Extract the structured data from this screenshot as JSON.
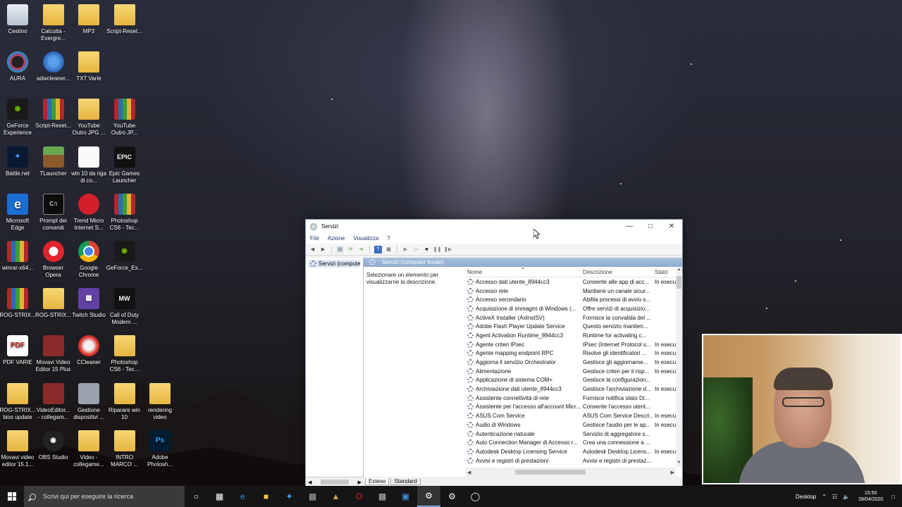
{
  "desktop": {
    "icons": [
      {
        "label": "Cestino",
        "icon": "recycle-bin-icon"
      },
      {
        "label": "Calcutta - Evergre...",
        "icon": "file-icon"
      },
      {
        "label": "MP3",
        "icon": "file-icon"
      },
      {
        "label": "Script-Reset...",
        "icon": "folder-icon"
      },
      {
        "label": "AURA",
        "icon": "aura-icon"
      },
      {
        "label": "adwcleaner...",
        "icon": "adwcleaner-icon"
      },
      {
        "label": "TXT Varie",
        "icon": "file-icon"
      },
      {
        "label": "GeForce Experience",
        "icon": "nvidia-icon"
      },
      {
        "label": "Script-Reset...",
        "icon": "winrar-icon"
      },
      {
        "label": "YouTube Outro JPG ...",
        "icon": "file-icon"
      },
      {
        "label": "YouTube Outro JP...",
        "icon": "winrar-icon"
      },
      {
        "label": "Battle.net",
        "icon": "battlenet-icon"
      },
      {
        "label": "TLauncher",
        "icon": "minecraft-icon"
      },
      {
        "label": "win 10 da riga di co...",
        "icon": "text-file-icon"
      },
      {
        "label": "Epic Games Launcher",
        "icon": "epic-games-icon"
      },
      {
        "label": "Microsoft Edge",
        "icon": "edge-icon"
      },
      {
        "label": "Prompt dei comandi",
        "icon": "cmd-icon"
      },
      {
        "label": "Trend Micro Internet S...",
        "icon": "trend-micro-icon"
      },
      {
        "label": "Photoshop CS6 - Tec...",
        "icon": "winrar-icon"
      },
      {
        "label": "winrar-x64...",
        "icon": "winrar-icon"
      },
      {
        "label": "Browser Opera",
        "icon": "opera-icon"
      },
      {
        "label": "Google Chrome",
        "icon": "chrome-icon"
      },
      {
        "label": "GeForce_Ex...",
        "icon": "nvidia-icon"
      },
      {
        "label": "ROG-STRIX...",
        "icon": "winrar-icon"
      },
      {
        "label": "ROG-STRIX...",
        "icon": "file-icon"
      },
      {
        "label": "Twitch Studio",
        "icon": "twitch-icon"
      },
      {
        "label": "Call of Duty Modern ...",
        "icon": "cod-icon"
      },
      {
        "label": "PDF VARIE",
        "icon": "pdf-icon"
      },
      {
        "label": "Movavi Video Editor 15 Plus",
        "icon": "movavi-icon"
      },
      {
        "label": "CCleaner",
        "icon": "ccleaner-icon"
      },
      {
        "label": "Photoshop CS6 - Tec...",
        "icon": "folder-icon"
      },
      {
        "label": "ROG-STRIX... bios update",
        "icon": "file-icon"
      },
      {
        "label": "VideoEditor... - collegam...",
        "icon": "movavi-icon"
      },
      {
        "label": "Gestione dispositivi ...",
        "icon": "device-manager-icon"
      },
      {
        "label": "Riparare win 10",
        "icon": "file-icon"
      },
      {
        "label": "rendering video",
        "icon": "file-icon"
      },
      {
        "label": "Movavi video editor 15.1...",
        "icon": "folder-icon"
      },
      {
        "label": "OBS Studio",
        "icon": "obs-icon"
      },
      {
        "label": "Video - collegame...",
        "icon": "file-icon"
      },
      {
        "label": "INTRO MARCO ...",
        "icon": "file-icon"
      },
      {
        "label": "Adobe Photosh...",
        "icon": "photoshop-icon"
      }
    ]
  },
  "window": {
    "title": "Servizi",
    "menu": [
      "File",
      "Azione",
      "Visualizza",
      "?"
    ],
    "tree_item": "Servizi (computer",
    "header": "Servizi (computer locale)",
    "description_hint": "Selezionare un elemento per visualizzarne la descrizione.",
    "columns": {
      "name": "Nome",
      "description": "Descrizione",
      "state": "Stato"
    },
    "tabs": [
      "Esteso",
      "Standard"
    ],
    "services": [
      {
        "name": "Accesso dati utente_8944cc3",
        "description": "Consente alle app di acc...",
        "state": "In esecu"
      },
      {
        "name": "Accesso rete",
        "description": "Mantiene un canale sicur...",
        "state": ""
      },
      {
        "name": "Accesso secondario",
        "description": "Abilita processi di avvio s...",
        "state": ""
      },
      {
        "name": "Acquisizione di immagini di Windows (...",
        "description": "Offre servizi di acquisizio...",
        "state": ""
      },
      {
        "name": "ActiveX Installer (AxInstSV)",
        "description": "Fornisce la convalida del ...",
        "state": ""
      },
      {
        "name": "Adobe Flash Player Update Service",
        "description": "Questo servizio mantien...",
        "state": ""
      },
      {
        "name": "Agent Activation Runtime_8944cc3",
        "description": "Runtime for activating c...",
        "state": ""
      },
      {
        "name": "Agente criteri IPsec",
        "description": "IPsec (Internet Protocol s...",
        "state": "In esecu"
      },
      {
        "name": "Agente mapping endpoint RPC",
        "description": "Risolve gli identificatori ...",
        "state": "In esecu"
      },
      {
        "name": "Aggiorna il servizio Orchestrator",
        "description": "Gestisce gli aggiorname...",
        "state": "In esecu"
      },
      {
        "name": "Alimentazione",
        "description": "Gestisce criteri per il risp...",
        "state": "In esecu"
      },
      {
        "name": "Applicazione di sistema COM+",
        "description": "Gestisce la configurazion...",
        "state": ""
      },
      {
        "name": "Archiviazione dati utente_8944cc3",
        "description": "Gestisce l'archiviazione d...",
        "state": "In esecu"
      },
      {
        "name": "Assistente connettività di rete",
        "description": "Fornisce notifica stato Di...",
        "state": ""
      },
      {
        "name": "Assistente per l'accesso all'account Micr...",
        "description": "Consente l'accesso utent...",
        "state": ""
      },
      {
        "name": "ASUS Com Service",
        "description": "ASUS Com Service Descri...",
        "state": "In esecu"
      },
      {
        "name": "Audio di Windows",
        "description": "Gestisce l'audio per le ap...",
        "state": "In esecu"
      },
      {
        "name": "Autenticazione naturale",
        "description": "Servizio di aggregatore s...",
        "state": ""
      },
      {
        "name": "Auto Connection Manager di Accesso r...",
        "description": "Crea una connessione a ...",
        "state": ""
      },
      {
        "name": "Autodesk Desktop Licensing Service",
        "description": "Autodesk Desktop Licens...",
        "state": "In esecu"
      },
      {
        "name": "Avvisi e registri di prestazioni",
        "description": "Avvisi e registri di prestaz...",
        "state": ""
      }
    ]
  },
  "taskbar": {
    "search_placeholder": "Scrivi qui per eseguire la ricerca",
    "desktop_label": "Desktop",
    "time": "15:50",
    "date": "28/04/2020"
  }
}
